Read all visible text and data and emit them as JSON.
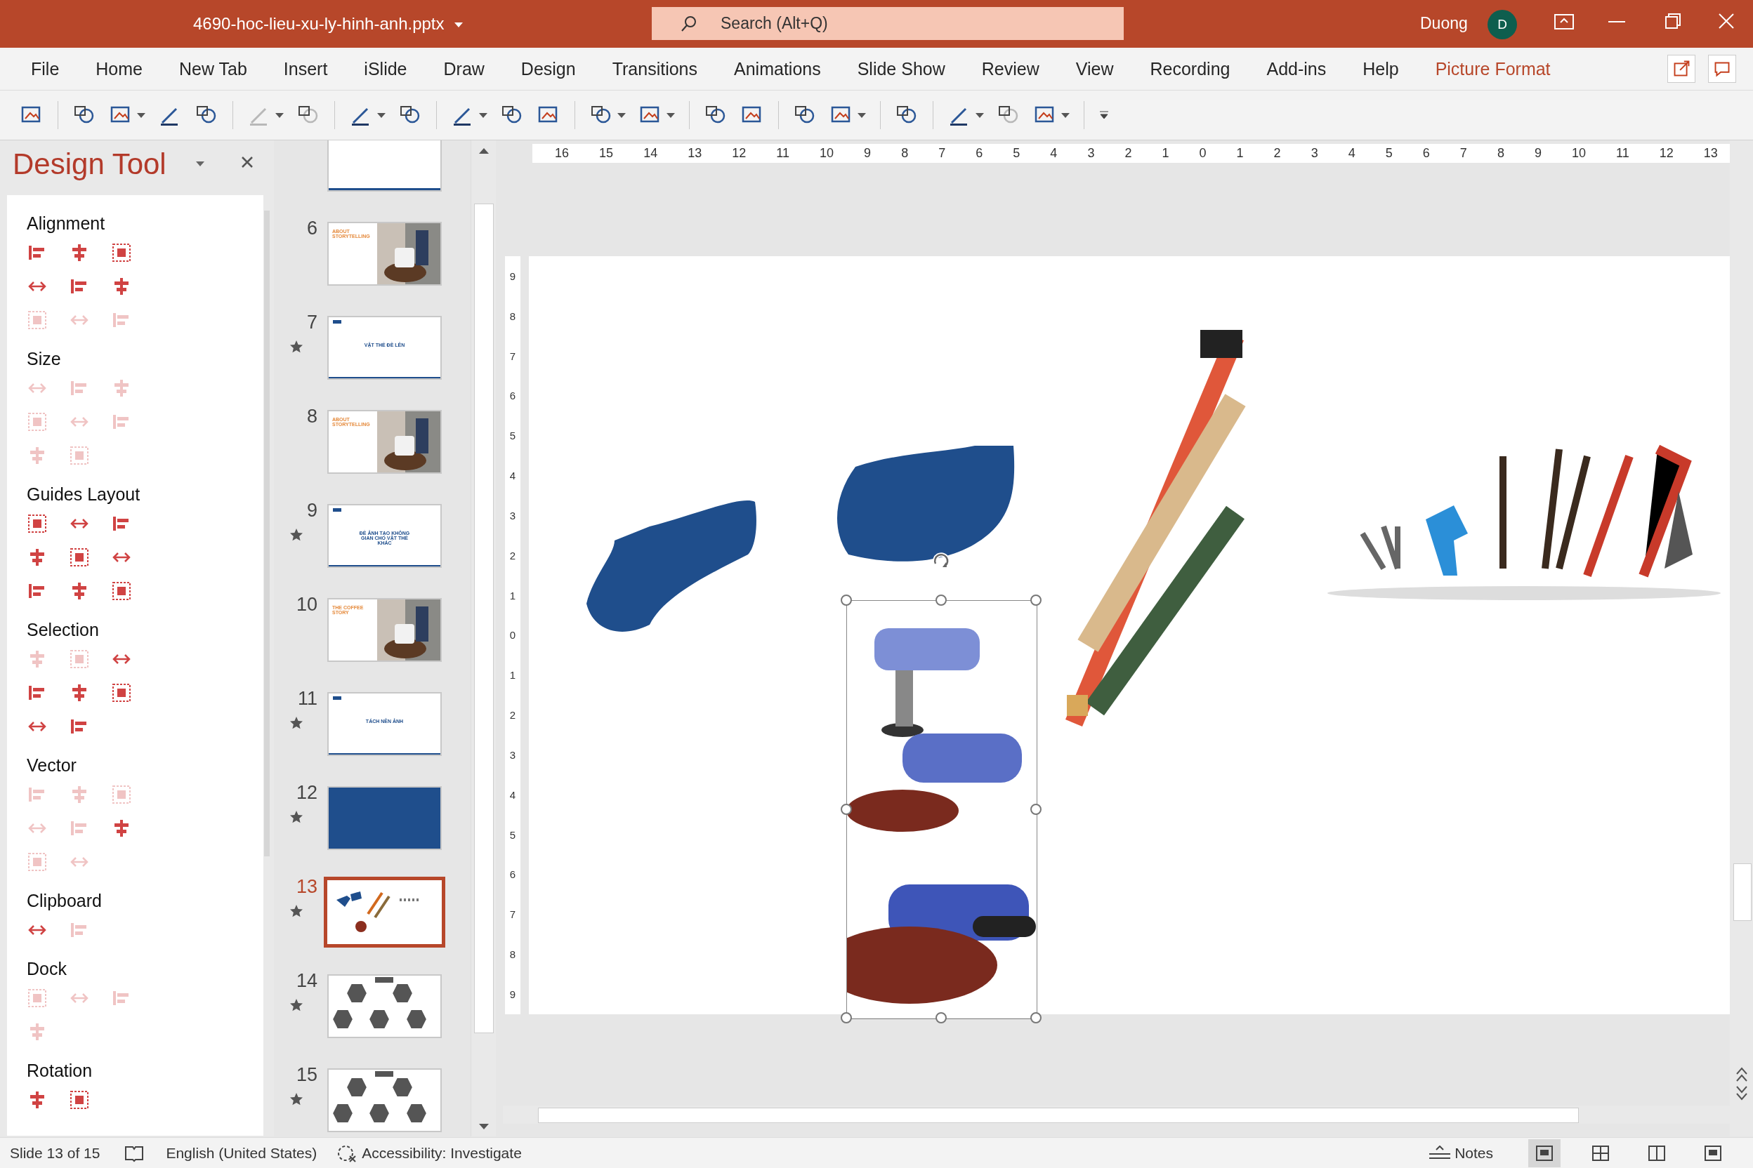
{
  "title_bar": {
    "file_name": "4690-hoc-lieu-xu-ly-hinh-anh.pptx",
    "search_placeholder": "Search (Alt+Q)",
    "user_name": "Duong",
    "avatar_initial": "D"
  },
  "menu_tabs": [
    {
      "label": "File",
      "selected": false
    },
    {
      "label": "Home",
      "selected": false
    },
    {
      "label": "New Tab",
      "selected": false
    },
    {
      "label": "Insert",
      "selected": false
    },
    {
      "label": "iSlide",
      "selected": false
    },
    {
      "label": "Draw",
      "selected": false
    },
    {
      "label": "Design",
      "selected": false
    },
    {
      "label": "Transitions",
      "selected": false
    },
    {
      "label": "Animations",
      "selected": false
    },
    {
      "label": "Slide Show",
      "selected": false
    },
    {
      "label": "Review",
      "selected": false
    },
    {
      "label": "View",
      "selected": false
    },
    {
      "label": "Recording",
      "selected": false
    },
    {
      "label": "Add-ins",
      "selected": false
    },
    {
      "label": "Help",
      "selected": false
    },
    {
      "label": "Picture Format",
      "selected": true
    }
  ],
  "toolbar": [
    {
      "kind": "icon",
      "dropdown": false,
      "disabled": false
    },
    {
      "kind": "separator"
    },
    {
      "kind": "icon",
      "dropdown": false,
      "disabled": false
    },
    {
      "kind": "icon",
      "dropdown": true,
      "disabled": false
    },
    {
      "kind": "icon",
      "dropdown": false,
      "disabled": false
    },
    {
      "kind": "icon",
      "dropdown": false,
      "disabled": false
    },
    {
      "kind": "separator"
    },
    {
      "kind": "icon",
      "dropdown": true,
      "disabled": true
    },
    {
      "kind": "icon",
      "dropdown": false,
      "disabled": true
    },
    {
      "kind": "separator"
    },
    {
      "kind": "icon",
      "dropdown": true,
      "disabled": false
    },
    {
      "kind": "icon",
      "dropdown": false,
      "disabled": false
    },
    {
      "kind": "separator"
    },
    {
      "kind": "icon",
      "dropdown": true,
      "disabled": false
    },
    {
      "kind": "icon",
      "dropdown": false,
      "disabled": false
    },
    {
      "kind": "icon",
      "dropdown": false,
      "disabled": false
    },
    {
      "kind": "separator"
    },
    {
      "kind": "icon",
      "dropdown": true,
      "disabled": false
    },
    {
      "kind": "icon",
      "dropdown": true,
      "disabled": false
    },
    {
      "kind": "separator"
    },
    {
      "kind": "icon",
      "dropdown": false,
      "disabled": false
    },
    {
      "kind": "icon",
      "dropdown": false,
      "disabled": false
    },
    {
      "kind": "separator"
    },
    {
      "kind": "icon",
      "dropdown": false,
      "disabled": false
    },
    {
      "kind": "icon",
      "dropdown": true,
      "disabled": false
    },
    {
      "kind": "separator"
    },
    {
      "kind": "icon",
      "dropdown": false,
      "disabled": false
    },
    {
      "kind": "separator"
    },
    {
      "kind": "icon",
      "dropdown": true,
      "disabled": false
    },
    {
      "kind": "icon",
      "dropdown": false,
      "disabled": true
    },
    {
      "kind": "icon",
      "dropdown": true,
      "disabled": false
    },
    {
      "kind": "separator"
    },
    {
      "kind": "caret"
    }
  ],
  "design_tool": {
    "title": "Design Tool",
    "sections": [
      {
        "label": "Alignment",
        "tools": [
          {
            "disabled": false
          },
          {
            "disabled": false
          },
          {
            "disabled": false
          },
          {
            "disabled": false
          },
          {
            "disabled": false
          },
          {
            "disabled": false
          },
          {
            "disabled": true
          },
          {
            "disabled": true
          },
          {
            "disabled": true
          }
        ]
      },
      {
        "label": "Size",
        "tools": [
          {
            "disabled": true
          },
          {
            "disabled": true
          },
          {
            "disabled": true
          },
          {
            "disabled": true
          },
          {
            "disabled": true
          },
          {
            "disabled": true
          },
          {
            "disabled": true
          },
          {
            "disabled": true
          }
        ]
      },
      {
        "label": "Guides Layout",
        "tools": [
          {
            "disabled": false
          },
          {
            "disabled": false
          },
          {
            "disabled": false
          },
          {
            "disabled": false
          },
          {
            "disabled": false
          },
          {
            "disabled": false
          },
          {
            "disabled": false
          },
          {
            "disabled": false
          },
          {
            "disabled": false
          }
        ]
      },
      {
        "label": "Selection",
        "tools": [
          {
            "disabled": true
          },
          {
            "disabled": true
          },
          {
            "disabled": false
          },
          {
            "disabled": false
          },
          {
            "disabled": false
          },
          {
            "disabled": false
          },
          {
            "disabled": false
          },
          {
            "disabled": false
          }
        ]
      },
      {
        "label": "Vector",
        "tools": [
          {
            "disabled": true
          },
          {
            "disabled": true
          },
          {
            "disabled": true
          },
          {
            "disabled": true
          },
          {
            "disabled": true
          },
          {
            "disabled": false
          },
          {
            "disabled": true
          },
          {
            "disabled": true
          }
        ]
      },
      {
        "label": "Clipboard",
        "tools": [
          {
            "disabled": false
          },
          {
            "disabled": true
          }
        ]
      },
      {
        "label": "Dock",
        "tools": [
          {
            "disabled": true
          },
          {
            "disabled": true
          },
          {
            "disabled": true
          },
          {
            "disabled": true
          }
        ]
      },
      {
        "label": "Rotation",
        "tools": [
          {
            "disabled": false
          },
          {
            "disabled": false
          }
        ]
      }
    ]
  },
  "slides": [
    {
      "kind": "partial",
      "starred": false,
      "selected": false
    },
    {
      "number": "6",
      "title": "ABOUT STORYTELLING",
      "starred": false,
      "selected": false
    },
    {
      "number": "7",
      "kind": "text",
      "title": "VẬT THỂ ĐÈ LÊN",
      "starred": true,
      "selected": false
    },
    {
      "number": "8",
      "title": "ABOUT STORYTELLING",
      "starred": false,
      "selected": false
    },
    {
      "number": "9",
      "kind": "text",
      "title": "ĐỂ ẢNH TẠO KHÔNG GIAN CHO VẬT THỂ KHÁC",
      "starred": true,
      "selected": false
    },
    {
      "number": "10",
      "title": "THE COFFEE STORY",
      "starred": false,
      "selected": false
    },
    {
      "number": "11",
      "kind": "text",
      "title": "TÁCH NỀN ẢNH",
      "starred": true,
      "selected": false
    },
    {
      "number": "12",
      "kind": "blue",
      "starred": true,
      "selected": false
    },
    {
      "number": "13",
      "kind": "tools",
      "starred": true,
      "selected": true
    },
    {
      "number": "14",
      "kind": "hexagons",
      "starred": true,
      "selected": false
    },
    {
      "number": "15",
      "kind": "hexagons",
      "starred": true,
      "selected": false
    }
  ],
  "ruler": {
    "horizontal": [
      "16",
      "15",
      "14",
      "13",
      "12",
      "11",
      "10",
      "9",
      "8",
      "7",
      "6",
      "5",
      "4",
      "3",
      "2",
      "1",
      "0",
      "1",
      "2",
      "3",
      "4",
      "5",
      "6",
      "7",
      "8",
      "9",
      "10",
      "11",
      "12",
      "13"
    ],
    "vertical": [
      "9",
      "8",
      "7",
      "6",
      "5",
      "4",
      "3",
      "2",
      "1",
      "0",
      "1",
      "2",
      "3",
      "4",
      "5",
      "6",
      "7",
      "8",
      "9"
    ]
  },
  "slide": {
    "shapes": [
      {
        "kind": "blob"
      },
      {
        "kind": "blob"
      },
      {
        "kind": "picture"
      },
      {
        "kind": "picture"
      },
      {
        "kind": "picture",
        "selected": true
      }
    ]
  },
  "status_bar": {
    "slide_info": "Slide 13 of 15",
    "language": "English (United States)",
    "accessibility": "Accessibility: Investigate",
    "notes": "Notes",
    "views": [
      {
        "selected": true
      },
      {
        "selected": false
      },
      {
        "selected": false
      },
      {
        "selected": false
      }
    ]
  }
}
